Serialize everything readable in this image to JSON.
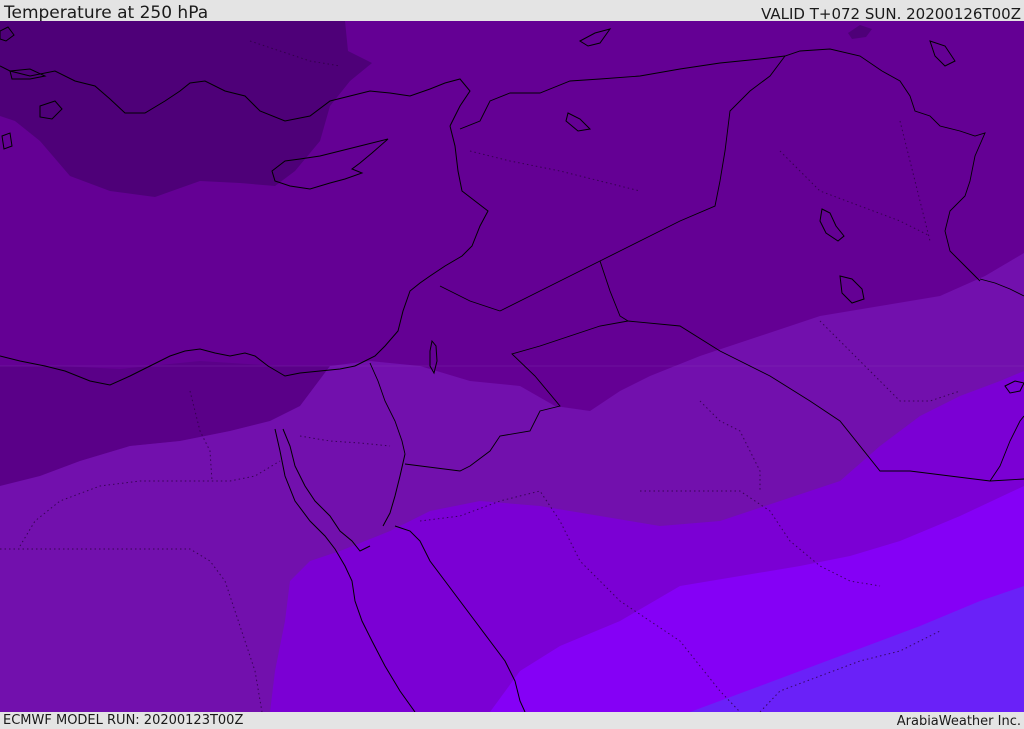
{
  "header": {
    "title": "Temperature at 250 hPa",
    "valid": "VALID T+072 SUN. 20200126T00Z"
  },
  "footer": {
    "model_run": "ECMWF MODEL RUN: 20200123T00Z",
    "credit": "ArabiaWeather Inc."
  },
  "map": {
    "field": "temperature",
    "level": "250 hPa",
    "colors": {
      "band_coldest": "#4e0078",
      "band_2": "#640094",
      "band_3": "#7210ad",
      "band_4": "#7b00d4",
      "band_5": "#8500f6",
      "band_warmest": "#6a21f8",
      "coastline": "#000000",
      "border": "#000000"
    }
  }
}
